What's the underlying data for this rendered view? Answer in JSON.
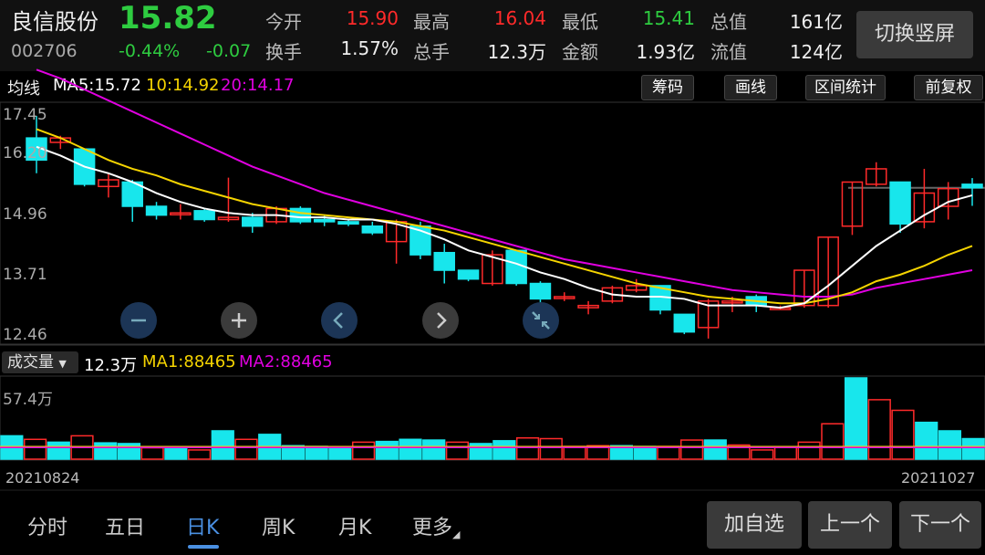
{
  "header": {
    "stock_name": "良信股份",
    "stock_code": "002706",
    "price": "15.82",
    "change_pct": "-0.44%",
    "change_amt": "-0.07",
    "quotes": [
      {
        "label": "今开",
        "value": "15.90",
        "color": "#ff2a2a"
      },
      {
        "label": "最高",
        "value": "16.04",
        "color": "#ff2a2a"
      },
      {
        "label": "最低",
        "value": "15.41",
        "color": "#2ecc40"
      },
      {
        "label": "总值",
        "value": "161亿",
        "color": "#eeeeee"
      },
      {
        "label": "换手",
        "value": "1.57%",
        "color": "#eeeeee"
      },
      {
        "label": "总手",
        "value": "12.3万",
        "color": "#eeeeee"
      },
      {
        "label": "金额",
        "value": "1.93亿",
        "color": "#eeeeee"
      },
      {
        "label": "流值",
        "value": "124亿",
        "color": "#eeeeee"
      }
    ],
    "switch_button": "切换竖屏"
  },
  "ma_bar": {
    "label": "均线",
    "ma5": "MA5:15.72",
    "ma10": "10:14.92",
    "ma20": "20:14.17",
    "buttons": [
      "筹码",
      "画线",
      "区间统计",
      "前复权"
    ]
  },
  "volume_bar": {
    "selector": "成交量",
    "total": "12.3万",
    "ma1": "MA1:88465",
    "ma2": "MA2:88465",
    "max_label": "57.4万"
  },
  "dates": {
    "start": "20210824",
    "end": "20211027"
  },
  "periods": [
    "分时",
    "五日",
    "日K",
    "周K",
    "月K",
    "更多"
  ],
  "active_period": "日K",
  "bottom_buttons": [
    "加自选",
    "上一个",
    "下一个"
  ],
  "zoom_icons": [
    "zoom-out-icon",
    "zoom-in-icon",
    "scroll-left-icon",
    "scroll-right-icon",
    "collapse-icon"
  ],
  "colors": {
    "up": "#ff2a2a",
    "down": "#18e6ec",
    "ma5": "#ffffff",
    "ma10": "#f5d400",
    "ma20": "#e000e0",
    "price": "#2ecc40",
    "active_tab": "#4a90e2"
  },
  "chart_data": {
    "type": "candlestick",
    "price_axis": {
      "ticks": [
        "17.45",
        "16.20",
        "14.96",
        "13.71",
        "12.46"
      ],
      "range": [
        12.46,
        17.45
      ]
    },
    "candles": [
      {
        "o": 16.95,
        "c": 16.45,
        "h": 17.45,
        "l": 16.15
      },
      {
        "o": 16.85,
        "c": 16.95,
        "h": 17.0,
        "l": 16.7
      },
      {
        "o": 16.7,
        "c": 15.9,
        "h": 16.7,
        "l": 15.85
      },
      {
        "o": 15.85,
        "c": 16.0,
        "h": 16.15,
        "l": 15.6
      },
      {
        "o": 15.95,
        "c": 15.4,
        "h": 16.0,
        "l": 15.05
      },
      {
        "o": 15.4,
        "c": 15.2,
        "h": 15.5,
        "l": 15.1
      },
      {
        "o": 15.25,
        "c": 15.25,
        "h": 15.45,
        "l": 15.1
      },
      {
        "o": 15.3,
        "c": 15.1,
        "h": 15.35,
        "l": 15.05
      },
      {
        "o": 15.1,
        "c": 15.15,
        "h": 16.05,
        "l": 15.05
      },
      {
        "o": 15.15,
        "c": 14.95,
        "h": 15.25,
        "l": 14.8
      },
      {
        "o": 15.05,
        "c": 15.35,
        "h": 15.4,
        "l": 15.0
      },
      {
        "o": 15.35,
        "c": 15.05,
        "h": 15.4,
        "l": 15.0
      },
      {
        "o": 15.1,
        "c": 15.05,
        "h": 15.2,
        "l": 14.95
      },
      {
        "o": 15.05,
        "c": 15.0,
        "h": 15.1,
        "l": 14.95
      },
      {
        "o": 14.95,
        "c": 14.8,
        "h": 15.05,
        "l": 14.75
      },
      {
        "o": 14.6,
        "c": 15.05,
        "h": 15.1,
        "l": 14.1
      },
      {
        "o": 14.95,
        "c": 14.3,
        "h": 15.05,
        "l": 14.2
      },
      {
        "o": 14.35,
        "c": 13.95,
        "h": 14.55,
        "l": 13.65
      },
      {
        "o": 13.95,
        "c": 13.75,
        "h": 13.95,
        "l": 13.7
      },
      {
        "o": 13.65,
        "c": 14.3,
        "h": 14.4,
        "l": 13.6
      },
      {
        "o": 14.4,
        "c": 13.65,
        "h": 14.4,
        "l": 13.6
      },
      {
        "o": 13.65,
        "c": 13.3,
        "h": 13.7,
        "l": 13.15
      },
      {
        "o": 13.35,
        "c": 13.35,
        "h": 13.45,
        "l": 13.25
      },
      {
        "o": 13.1,
        "c": 13.15,
        "h": 13.25,
        "l": 12.95
      },
      {
        "o": 13.25,
        "c": 13.55,
        "h": 13.6,
        "l": 13.2
      },
      {
        "o": 13.5,
        "c": 13.6,
        "h": 13.75,
        "l": 13.45
      },
      {
        "o": 13.6,
        "c": 13.05,
        "h": 13.6,
        "l": 12.95
      },
      {
        "o": 12.95,
        "c": 12.55,
        "h": 12.95,
        "l": 12.5
      },
      {
        "o": 12.65,
        "c": 13.25,
        "h": 13.3,
        "l": 12.4
      },
      {
        "o": 13.25,
        "c": 13.25,
        "h": 13.35,
        "l": 13.0
      },
      {
        "o": 13.35,
        "c": 13.15,
        "h": 13.4,
        "l": 13.0
      },
      {
        "o": 13.1,
        "c": 13.1,
        "h": 13.15,
        "l": 13.05
      },
      {
        "o": 13.15,
        "c": 13.95,
        "h": 13.95,
        "l": 13.1
      },
      {
        "o": 13.15,
        "c": 14.7,
        "h": 14.7,
        "l": 13.1
      },
      {
        "o": 14.95,
        "c": 15.95,
        "h": 15.95,
        "l": 14.75
      },
      {
        "o": 15.9,
        "c": 16.25,
        "h": 16.4,
        "l": 15.85
      },
      {
        "o": 15.95,
        "c": 15.0,
        "h": 15.95,
        "l": 14.8
      },
      {
        "o": 15.05,
        "c": 15.7,
        "h": 16.25,
        "l": 14.9
      },
      {
        "o": 15.4,
        "c": 15.8,
        "h": 15.95,
        "l": 15.1
      },
      {
        "o": 15.9,
        "c": 15.82,
        "h": 16.04,
        "l": 15.41
      }
    ],
    "ma5": [
      16.75,
      16.55,
      16.3,
      16.15,
      15.95,
      15.7,
      15.5,
      15.35,
      15.25,
      15.2,
      15.2,
      15.15,
      15.15,
      15.1,
      15.1,
      15.0,
      14.85,
      14.65,
      14.4,
      14.25,
      14.1,
      13.9,
      13.75,
      13.55,
      13.4,
      13.35,
      13.35,
      13.3,
      13.15,
      13.15,
      13.15,
      13.1,
      13.2,
      13.6,
      14.05,
      14.5,
      14.85,
      15.2,
      15.5,
      15.65
    ],
    "ma10": [
      17.15,
      16.95,
      16.7,
      16.45,
      16.25,
      16.1,
      15.9,
      15.75,
      15.6,
      15.45,
      15.35,
      15.25,
      15.2,
      15.15,
      15.1,
      15.05,
      14.95,
      14.85,
      14.7,
      14.55,
      14.4,
      14.25,
      14.1,
      13.95,
      13.8,
      13.65,
      13.55,
      13.45,
      13.35,
      13.3,
      13.25,
      13.2,
      13.2,
      13.3,
      13.45,
      13.7,
      13.85,
      14.05,
      14.3,
      14.5
    ],
    "ma20": [
      18.5,
      18.3,
      18.05,
      17.8,
      17.55,
      17.3,
      17.05,
      16.8,
      16.55,
      16.3,
      16.1,
      15.9,
      15.7,
      15.55,
      15.4,
      15.25,
      15.1,
      14.95,
      14.8,
      14.65,
      14.5,
      14.35,
      14.2,
      14.1,
      14.0,
      13.9,
      13.8,
      13.7,
      13.6,
      13.5,
      13.45,
      13.4,
      13.35,
      13.35,
      13.4,
      13.55,
      13.65,
      13.75,
      13.85,
      13.95
    ],
    "volume_axis": {
      "max_label": "57.4万",
      "max": 574000
    },
    "volumes": [
      165000,
      140000,
      120000,
      165000,
      115000,
      110000,
      80000,
      75000,
      65000,
      200000,
      140000,
      175000,
      95000,
      90000,
      80000,
      120000,
      125000,
      140000,
      135000,
      120000,
      110000,
      130000,
      150000,
      145000,
      90000,
      95000,
      95000,
      90000,
      90000,
      135000,
      135000,
      100000,
      65000,
      85000,
      120000,
      250000,
      574000,
      420000,
      345000,
      260000,
      200000,
      145000
    ]
  }
}
